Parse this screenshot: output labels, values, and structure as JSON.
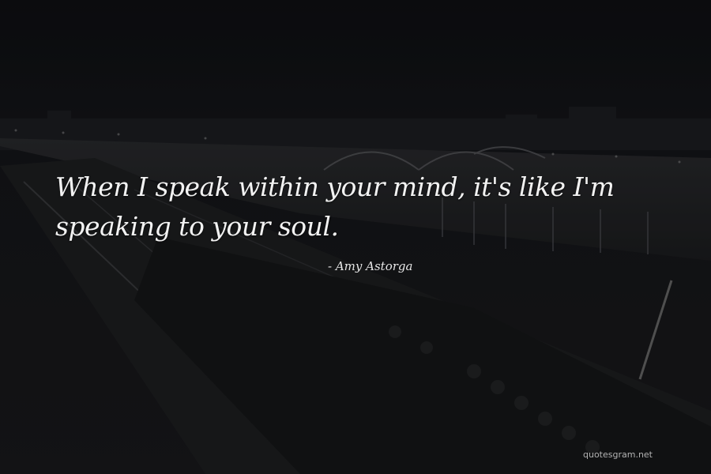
{
  "quote": {
    "text": "When I speak within your mind, it's like I'm speaking to your soul.",
    "author": "- Amy Astorga"
  },
  "watermark": "quotesgram.net"
}
